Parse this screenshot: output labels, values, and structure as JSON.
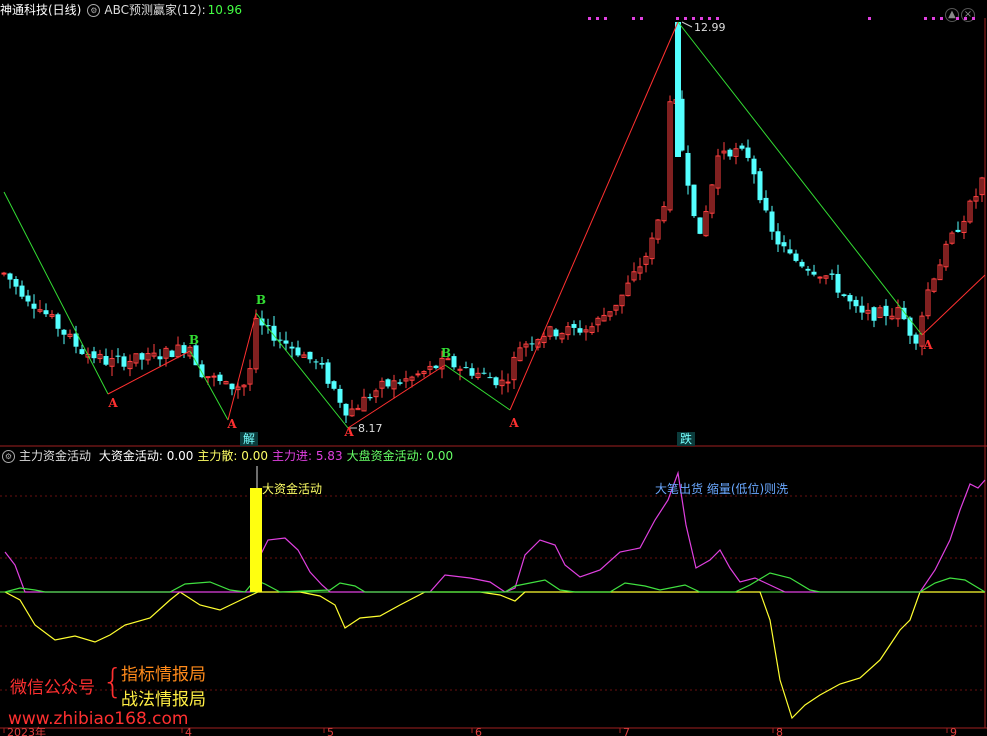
{
  "main_header": {
    "stock_name": "神通科技(日线)",
    "indicator_name": "ABC预测赢家(12)",
    "indicator_sep": ":",
    "indicator_value": "10.96"
  },
  "sub_header": {
    "indicator_name": "主力资金活动",
    "fields": [
      {
        "label": "大资金活动:",
        "value": "0.00",
        "color": "#ffffff"
      },
      {
        "label": "主力散:",
        "value": "0.00",
        "color": "#ffff66"
      },
      {
        "label": "主力进:",
        "value": "5.83",
        "color": "#e040e0"
      },
      {
        "label": "大盘资金活动:",
        "value": "0.00",
        "color": "#66ff66"
      }
    ]
  },
  "annotations": {
    "high_price": "12.99",
    "low_price": "8.17",
    "badge_jie": "解",
    "badge_die": "跌",
    "big_money_label": "大资金活动",
    "sell_label": "大笔出货 缩量(低位)则洗",
    "wave_labels": [
      "A",
      "B",
      "A",
      "B",
      "A",
      "B",
      "A",
      "A"
    ]
  },
  "x_axis": {
    "labels": [
      "2023年",
      "4",
      "5",
      "6",
      "7",
      "8",
      "9"
    ]
  },
  "watermark": {
    "wechat": "微信公众号",
    "brace": "{",
    "line1": "指标情报局",
    "line2": "战法情报局",
    "site": "www.zhibiao168.com"
  },
  "colors": {
    "up": "#ff4040",
    "down": "#54ffff",
    "zig_up": "#ff3030",
    "zig_down": "#33dd33",
    "purple": "#e040e0",
    "yellow": "#ffff30",
    "green": "#40e040"
  }
}
